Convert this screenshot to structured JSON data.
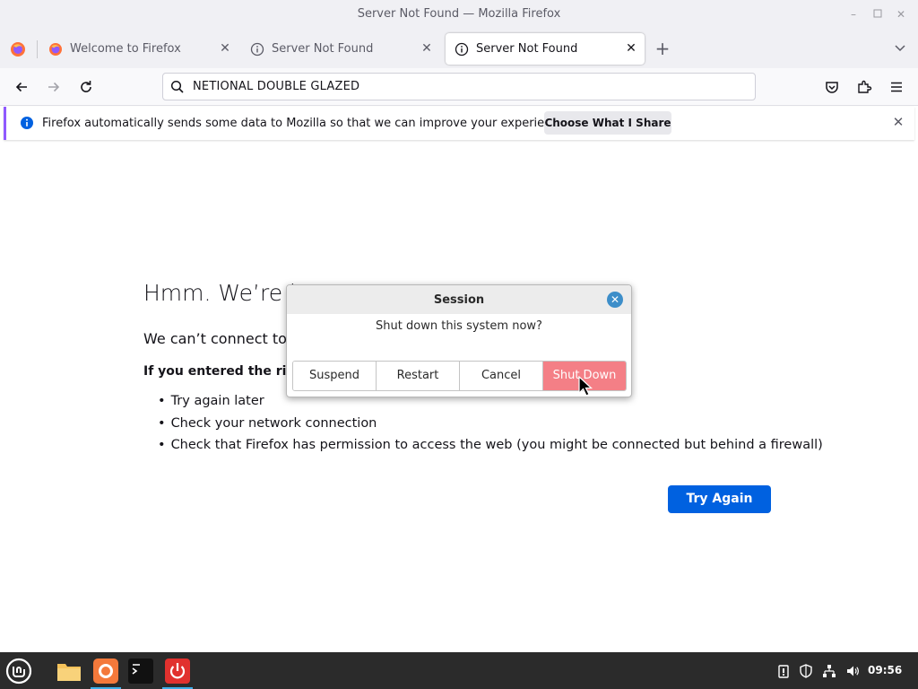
{
  "window": {
    "title": "Server Not Found — Mozilla Firefox",
    "controls": [
      "minimize-icon",
      "maximize-icon",
      "close-icon"
    ]
  },
  "tabs": [
    {
      "label": "Welcome to Firefox",
      "icon": "firefox-icon",
      "active": false
    },
    {
      "label": "Server Not Found",
      "icon": "info-icon",
      "active": false
    },
    {
      "label": "Server Not Found",
      "icon": "info-icon",
      "active": true
    }
  ],
  "navbar": {
    "url": "NETIONAL DOUBLE GLAZED"
  },
  "notification": {
    "message": "Firefox automatically sends some data to Mozilla so that we can improve your experience.",
    "button": "Choose What I Share"
  },
  "error_page": {
    "title": "Hmm. We’re h",
    "subtitle": "We can’t connect to",
    "bold_line": "If you entered the righ",
    "suggestions": [
      "Try again later",
      "Check your network connection",
      "Check that Firefox has permission to access the web (you might be connected but behind a firewall)"
    ],
    "try_again": "Try Again"
  },
  "dialog": {
    "title": "Session",
    "message": "Shut down this system now?",
    "buttons": [
      "Suspend",
      "Restart",
      "Cancel",
      "Shut Down"
    ]
  },
  "taskbar": {
    "clock": "09:56"
  },
  "colors": {
    "accent_blue": "#0061e0",
    "notif_border": "#9059ff",
    "shutdown_button": "#f47f86",
    "taskbar": "#2b2b2b"
  }
}
